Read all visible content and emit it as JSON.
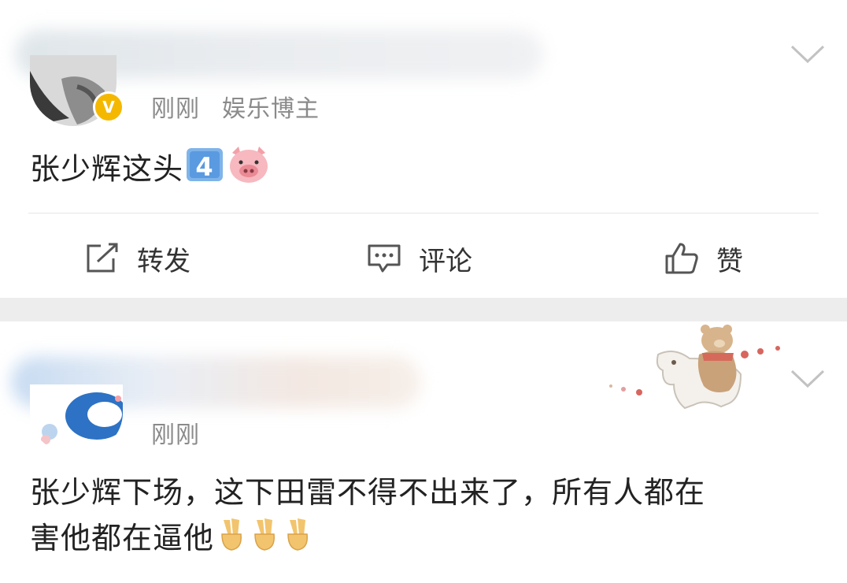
{
  "post1": {
    "time": "刚刚",
    "tag": "娱乐博主",
    "content": "张少辉这头",
    "content_emojis": [
      "keycap-4-emoji",
      "pig-face-emoji"
    ],
    "verified_badge": "V"
  },
  "actions": {
    "repost": "转发",
    "comment": "评论",
    "like": "赞"
  },
  "post2": {
    "time": "刚刚",
    "content_line1": "张少辉下场，这下田雷不得不出来了，所有人都在",
    "content_line2": "害他都在逼他",
    "content_emojis": [
      "victory-hand-emoji",
      "victory-hand-emoji",
      "victory-hand-emoji"
    ]
  },
  "colors": {
    "badge": "#f5b800",
    "separator": "#ededed",
    "meta_text": "#8a8a8a"
  }
}
